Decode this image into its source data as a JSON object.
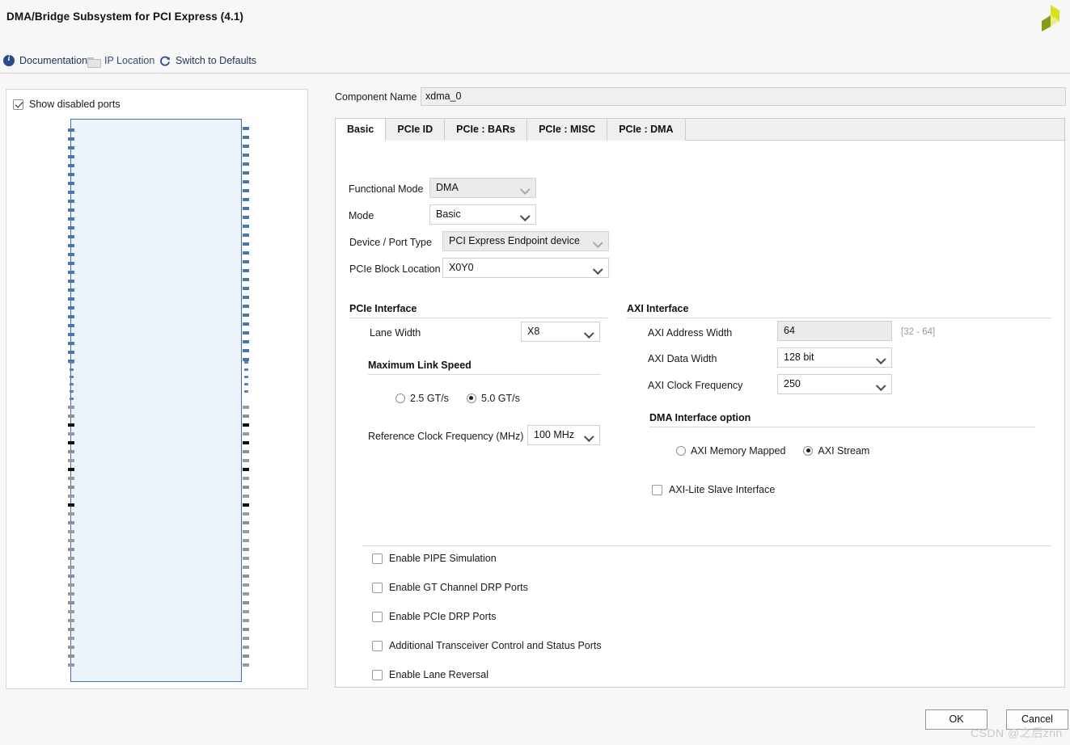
{
  "window": {
    "title": "DMA/Bridge Subsystem for PCI Express (4.1)",
    "logo_icon": "xilinx-logo-icon"
  },
  "toolbar": {
    "items": [
      {
        "label": "Documentation",
        "icon": "info-icon",
        "enabled": true
      },
      {
        "label": "IP Location",
        "icon": "folder-icon",
        "enabled": false
      },
      {
        "label": "Switch to Defaults",
        "icon": "refresh-icon",
        "enabled": true
      }
    ]
  },
  "preview": {
    "show_disabled_ports_label": "Show disabled ports",
    "show_disabled_ports_checked": true,
    "block_fill": "#edf3fb",
    "block_border": "#3f6fa8"
  },
  "component": {
    "name_label": "Component Name",
    "name_value": "xdma_0"
  },
  "tabs": [
    {
      "label": "Basic",
      "active": true
    },
    {
      "label": "PCIe ID",
      "active": false
    },
    {
      "label": "PCIe : BARs",
      "active": false
    },
    {
      "label": "PCIe : MISC",
      "active": false
    },
    {
      "label": "PCIe : DMA",
      "active": false
    }
  ],
  "basic": {
    "functional_mode": {
      "label": "Functional Mode",
      "value": "DMA",
      "enabled": false
    },
    "mode": {
      "label": "Mode",
      "value": "Basic",
      "enabled": true
    },
    "device_port_type": {
      "label": "Device / Port Type",
      "value": "PCI Express Endpoint device",
      "enabled": false
    },
    "pcie_block_location": {
      "label": "PCIe Block Location",
      "value": "X0Y0",
      "enabled": true
    }
  },
  "pcie_interface": {
    "title": "PCIe Interface",
    "lane_width": {
      "label": "Lane Width",
      "value": "X8"
    },
    "max_link_speed": {
      "title": "Maximum Link Speed",
      "options": [
        {
          "label": "2.5 GT/s",
          "selected": false
        },
        {
          "label": "5.0 GT/s",
          "selected": true
        }
      ]
    },
    "ref_clock": {
      "label": "Reference Clock Frequency (MHz)",
      "value": "100 MHz"
    }
  },
  "axi_interface": {
    "title": "AXI Interface",
    "address_width": {
      "label": "AXI Address Width",
      "value": "64",
      "hint": "[32 - 64]"
    },
    "data_width": {
      "label": "AXI Data Width",
      "value": "128 bit"
    },
    "clock_frequency": {
      "label": "AXI Clock Frequency",
      "value": "250"
    },
    "dma_option": {
      "title": "DMA Interface option",
      "options": [
        {
          "label": "AXI Memory Mapped",
          "selected": false
        },
        {
          "label": "AXI Stream",
          "selected": true
        }
      ]
    },
    "axi_lite_slave": {
      "label": "AXI-Lite Slave Interface",
      "checked": false
    }
  },
  "bottom_options": [
    {
      "label": "Enable PIPE Simulation",
      "checked": false
    },
    {
      "label": "Enable GT Channel DRP Ports",
      "checked": false
    },
    {
      "label": "Enable PCIe DRP Ports",
      "checked": false
    },
    {
      "label": "Additional Transceiver Control and Status Ports",
      "checked": false
    },
    {
      "label": "Enable Lane Reversal",
      "checked": false
    }
  ],
  "footer": {
    "ok_label": "OK",
    "cancel_label": "Cancel"
  },
  "watermark": {
    "text": "CSDN @之后zhh"
  }
}
